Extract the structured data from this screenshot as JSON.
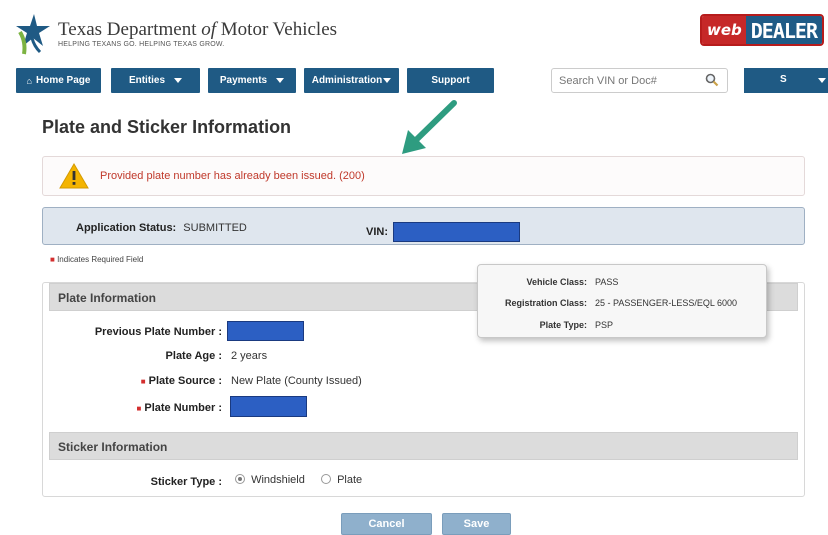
{
  "header": {
    "logo_title_part1": "Texas Department ",
    "logo_title_of": "of",
    "logo_title_part2": " Motor Vehicles",
    "logo_tagline": "HELPING TEXANS GO. HELPING TEXAS GROW.",
    "brand_web": "web",
    "brand_dealer": "DEALER"
  },
  "nav": {
    "home": "Home Page",
    "entities": "Entities",
    "payments": "Payments",
    "administration": "Administration",
    "support": "Support",
    "search_placeholder": "Search VIN or Doc#",
    "user": "S"
  },
  "page": {
    "title": "Plate and Sticker Information"
  },
  "alert": {
    "message": "Provided plate number has already been issued. (200)"
  },
  "status": {
    "app_status_label": "Application Status:",
    "app_status_value": "SUBMITTED",
    "vin_label": "VIN:"
  },
  "required_note": "Indicates Required Field",
  "vehicle_info": {
    "vehicle_class_label": "Vehicle Class:",
    "vehicle_class_value": "PASS",
    "registration_class_label": "Registration Class:",
    "registration_class_value": "25 - PASSENGER-LESS/EQL 6000",
    "plate_type_label": "Plate Type:",
    "plate_type_value": "PSP"
  },
  "plate_info": {
    "heading": "Plate Information",
    "previous_plate_label": "Previous Plate Number :",
    "plate_age_label": "Plate Age :",
    "plate_age_value": "2 years",
    "plate_source_label": "Plate Source :",
    "plate_source_value": "New Plate (County Issued)",
    "plate_number_label": "Plate Number :"
  },
  "sticker_info": {
    "heading": "Sticker Information",
    "sticker_type_label": "Sticker Type :",
    "options": [
      "Windshield",
      "Plate"
    ],
    "selected": "Windshield"
  },
  "actions": {
    "cancel": "Cancel",
    "save": "Save"
  },
  "colors": {
    "nav_blue": "#1f5a84",
    "alert_red": "#c0392b",
    "redaction_blue": "#2c5fc3",
    "arrow_green": "#2e9c80"
  }
}
